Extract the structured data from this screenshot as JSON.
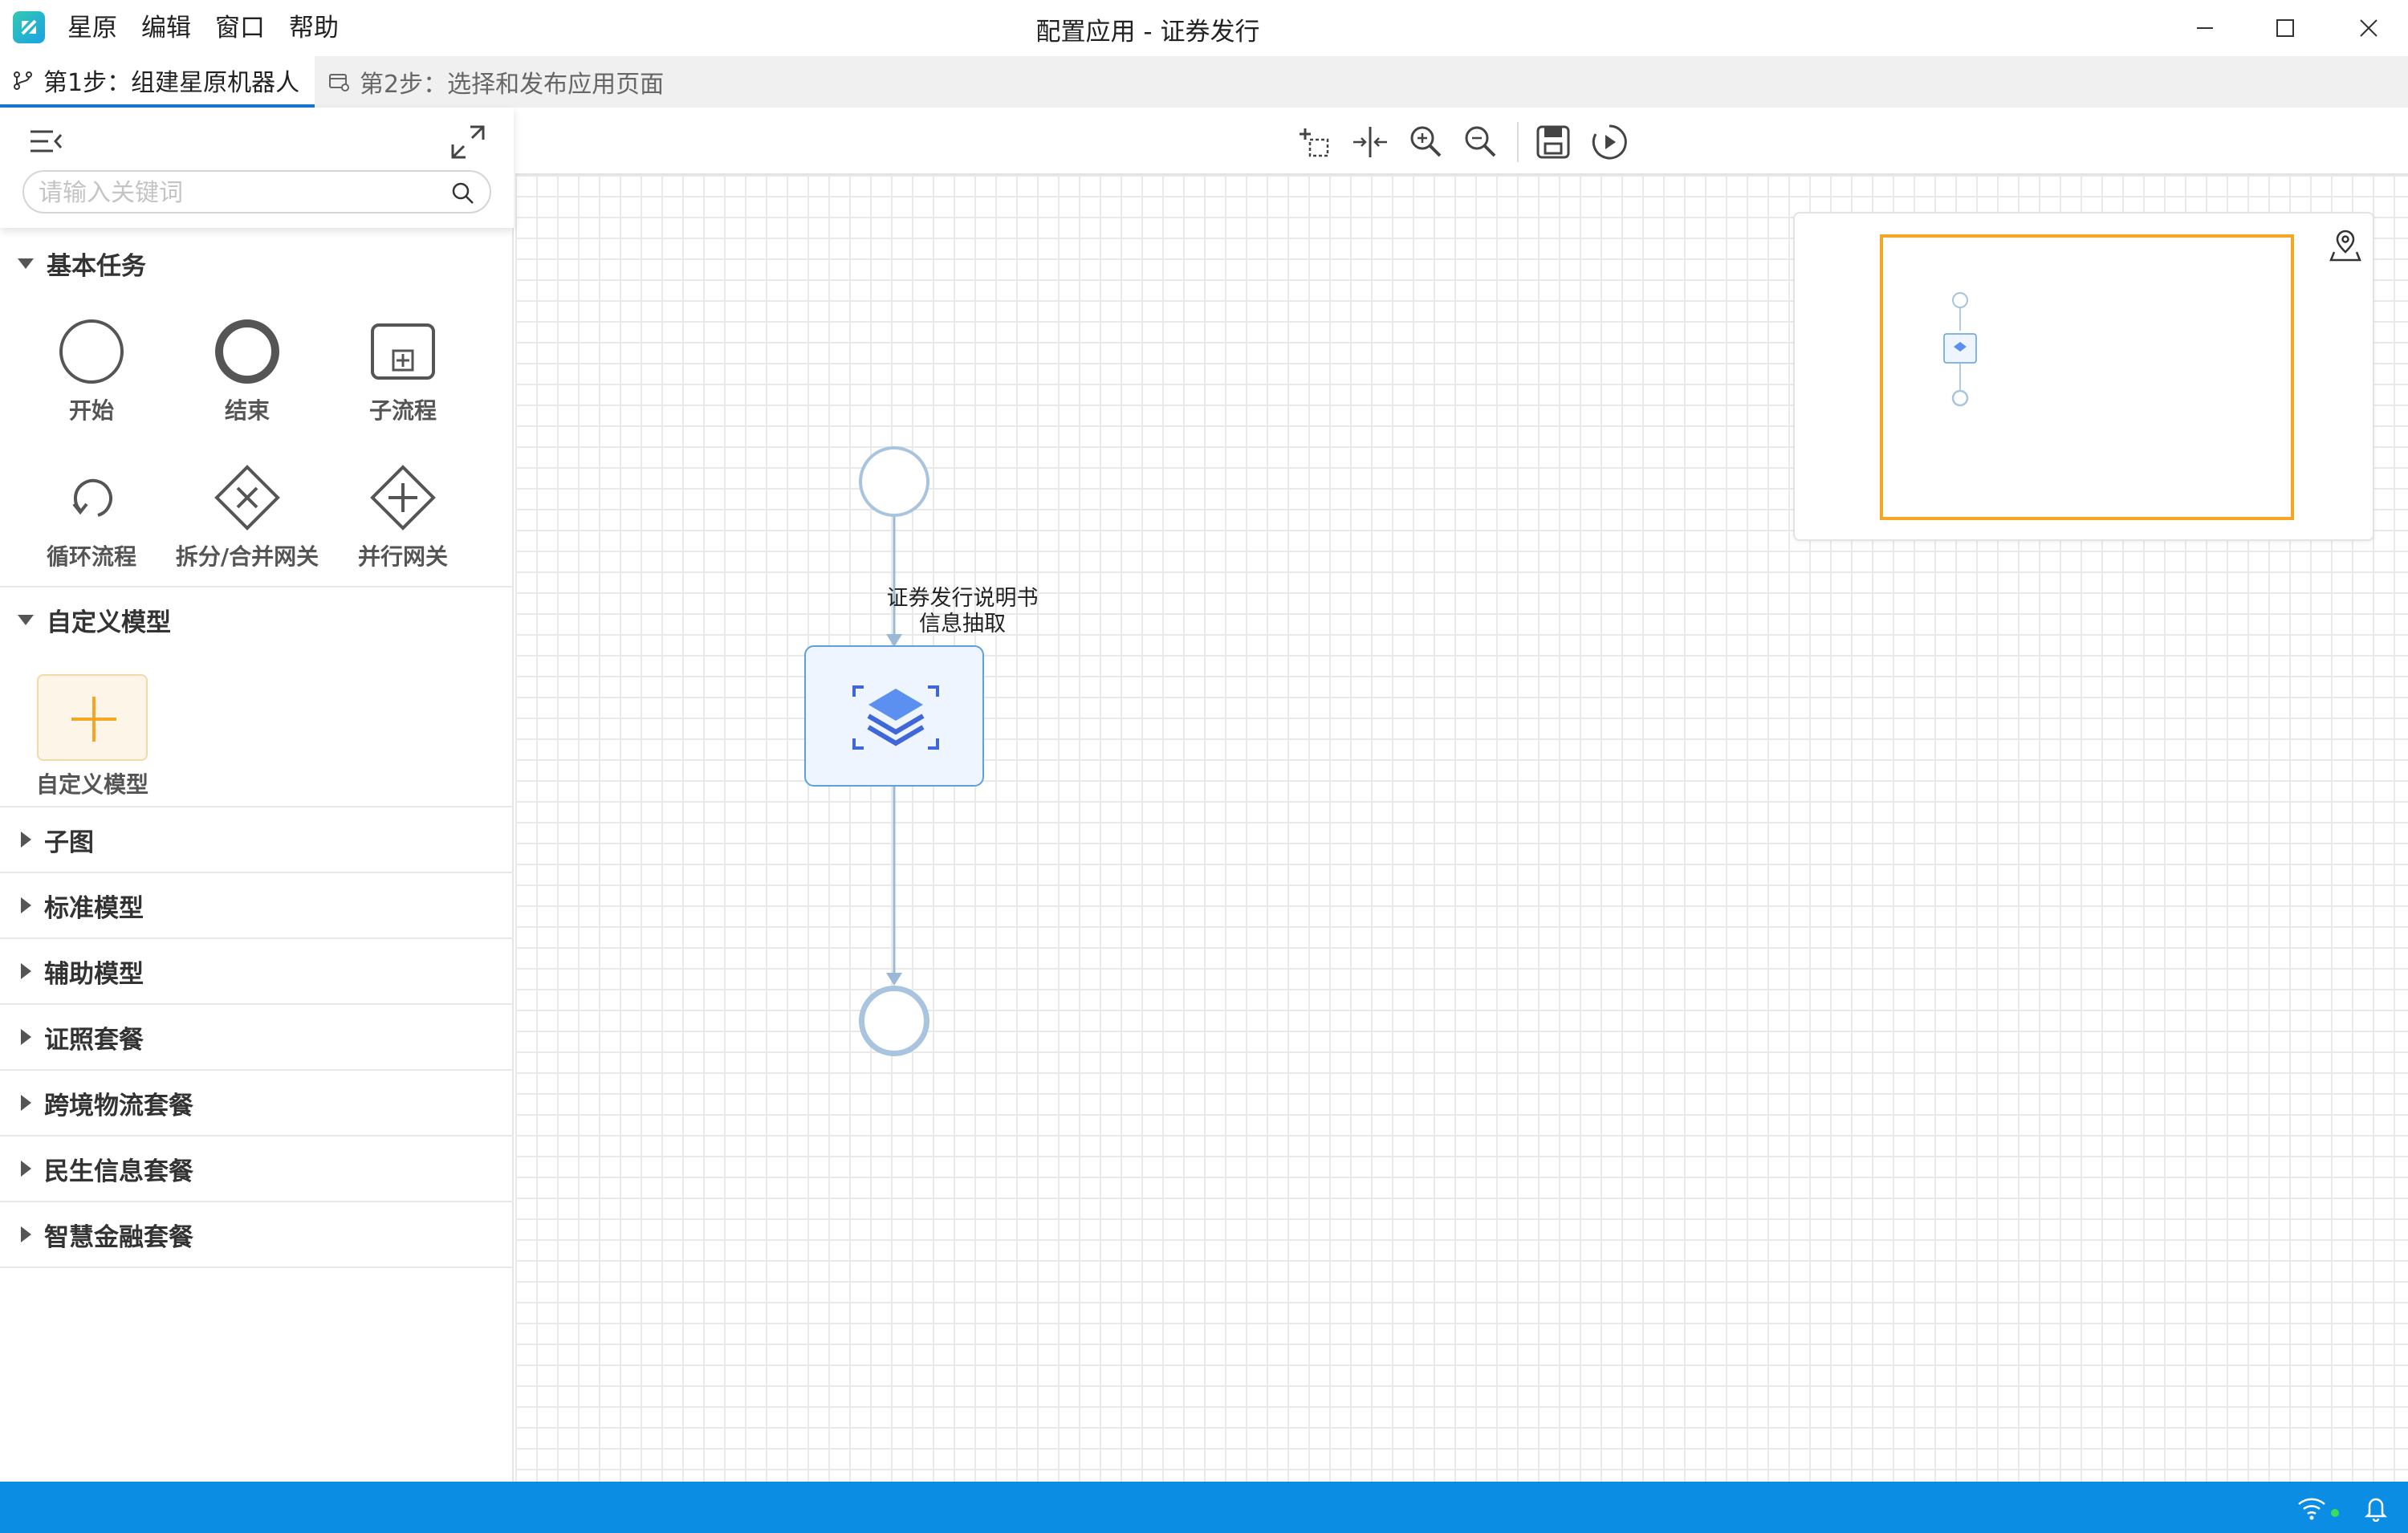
{
  "app": {
    "window_title": "配置应用 - 证券发行",
    "menu": [
      "星原",
      "编辑",
      "窗口",
      "帮助"
    ]
  },
  "tabs": [
    {
      "label": "第1步：组建星原机器人",
      "active": true
    },
    {
      "label": "第2步：选择和发布应用页面",
      "active": false
    }
  ],
  "sidebar": {
    "search_placeholder": "请输入关键词",
    "sections": [
      {
        "title": "基本任务",
        "expanded": true,
        "items": [
          "开始",
          "结束",
          "子流程",
          "循环流程",
          "拆分/合并网关",
          "并行网关"
        ]
      },
      {
        "title": "自定义模型",
        "expanded": true,
        "items": [
          "自定义模型"
        ]
      },
      {
        "title": "子图",
        "expanded": false
      },
      {
        "title": "标准模型",
        "expanded": false
      },
      {
        "title": "辅助模型",
        "expanded": false
      },
      {
        "title": "证照套餐",
        "expanded": false
      },
      {
        "title": "跨境物流套餐",
        "expanded": false
      },
      {
        "title": "民生信息套餐",
        "expanded": false
      },
      {
        "title": "智慧金融套餐",
        "expanded": false
      }
    ]
  },
  "canvas": {
    "toolbar": [
      "select-area-icon",
      "align-icon",
      "zoom-in-icon",
      "zoom-out-icon",
      "save-icon",
      "run-icon"
    ],
    "task_node": {
      "line1": "证券发行说明书",
      "line2": "信息抽取"
    }
  },
  "colors": {
    "accent": "#1677d2",
    "statusbar": "#0b8de4",
    "minimap_viewport": "#f5a623",
    "node_border": "#5e9fe0",
    "custom_model_bg": "#fdf6e8"
  }
}
